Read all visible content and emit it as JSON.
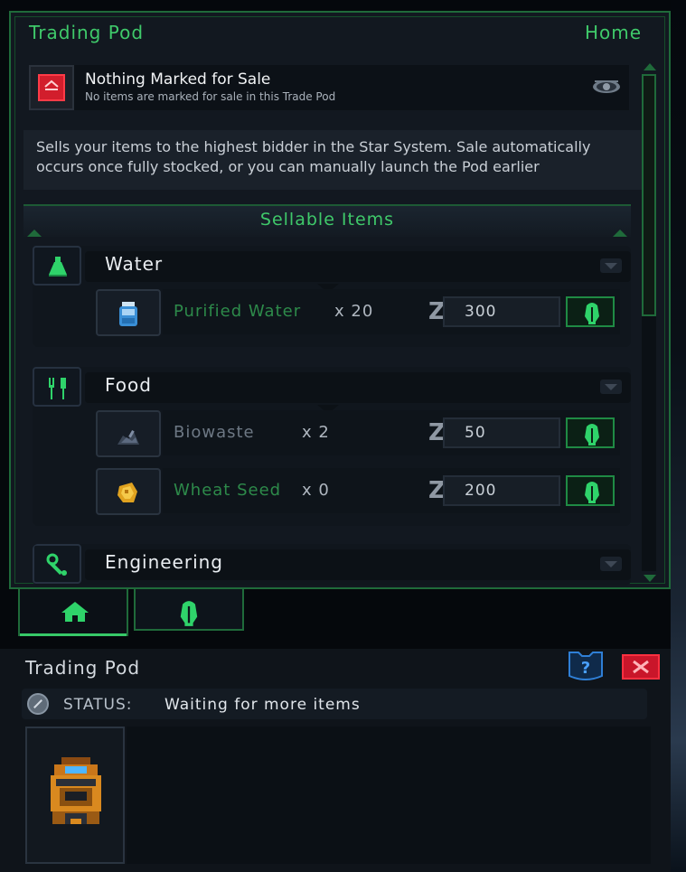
{
  "window": {
    "title": "Trading Pod",
    "home_label": "Home"
  },
  "sale_status": {
    "title": "Nothing Marked for Sale",
    "subtitle": "No items are marked for sale in this Trade Pod",
    "icon": "sale-icon",
    "eye_icon": "eye-icon"
  },
  "description": "Sells your items to the highest bidder in the Star System. Sale automatically occurs once fully stocked, or you can manually launch the Pod earlier",
  "section": {
    "title": "Sellable Items"
  },
  "categories": [
    {
      "name": "Water",
      "icon": "flask-icon",
      "items": [
        {
          "name": "Purified Water",
          "qty": "x 20",
          "price": "300",
          "currency_symbol": "Z",
          "icon": "water-bottle-icon"
        }
      ]
    },
    {
      "name": "Food",
      "icon": "fork-knife-icon",
      "items": [
        {
          "name": "Biowaste",
          "qty": "x 2",
          "price": "50",
          "currency_symbol": "Z",
          "icon": "biowaste-icon"
        },
        {
          "name": "Wheat Seed",
          "qty": "x 0",
          "price": "200",
          "currency_symbol": "Z",
          "icon": "wheat-seed-icon"
        }
      ]
    },
    {
      "name": "Engineering",
      "icon": "wrench-icon",
      "items": []
    }
  ],
  "tabs": [
    {
      "icon": "home-icon",
      "active": true
    },
    {
      "icon": "helmet-icon",
      "active": false
    }
  ],
  "bottom": {
    "title": "Trading Pod",
    "status_label": "STATUS:",
    "status_text": "Waiting for more items"
  },
  "colors": {
    "accent": "#3fc96a",
    "border": "#1f6a3a",
    "danger": "#d21e2c",
    "panel": "#121820"
  }
}
